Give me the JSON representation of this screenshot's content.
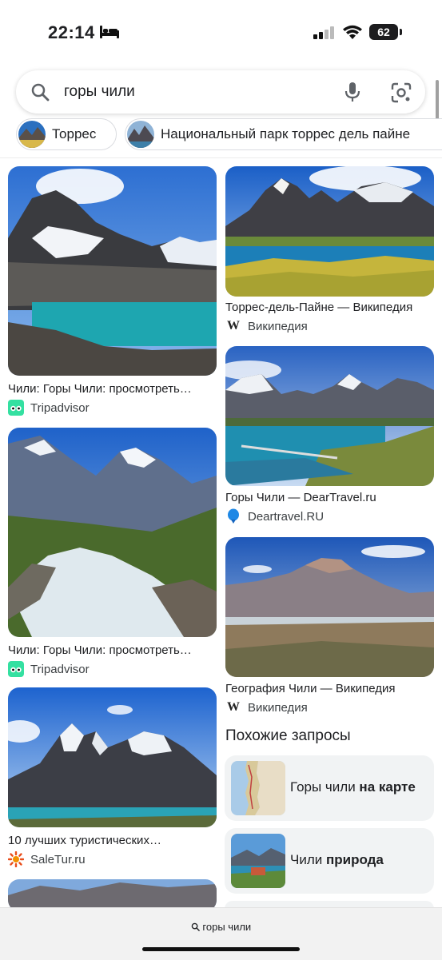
{
  "status": {
    "time": "22:14",
    "battery": "62",
    "icons": [
      "bed-icon",
      "signal-icon",
      "wifi-icon",
      "battery-icon"
    ]
  },
  "search": {
    "query": "горы чили",
    "icons": [
      "search-icon",
      "mic-icon",
      "lens-icon"
    ]
  },
  "chips": [
    {
      "label": "Торрес"
    },
    {
      "label": "Национальный парк торрес дель пайне"
    }
  ],
  "results": [
    {
      "title": "Чили: Горы Чили: просмотреть…",
      "source": "Tripadvisor",
      "favicon": "tripadvisor-icon"
    },
    {
      "title": "Торрес-дель-Пайне — Википедия",
      "source": "Википедия",
      "favicon": "wikipedia-icon"
    },
    {
      "title": "Чили: Горы Чили: просмотреть…",
      "source": "Tripadvisor",
      "favicon": "tripadvisor-icon"
    },
    {
      "title": "Горы Чили — DearTravel.ru",
      "source": "Deartravel.RU",
      "favicon": "balloon-icon"
    },
    {
      "title": "География Чили — Википедия",
      "source": "Википедия",
      "favicon": "wikipedia-icon"
    },
    {
      "title": "10 лучших туристических…",
      "source": "SaleTur.ru",
      "favicon": "saletur-icon"
    }
  ],
  "related": {
    "heading": "Похожие запросы",
    "items": [
      {
        "prefix": "Горы чили ",
        "bold": "на карте"
      },
      {
        "prefix": "Чили ",
        "bold": "природа"
      }
    ]
  },
  "bottom": {
    "query": "горы чили"
  },
  "colors": {
    "accent": "#1a73e8",
    "tripadvisor": "#34e0a1"
  }
}
